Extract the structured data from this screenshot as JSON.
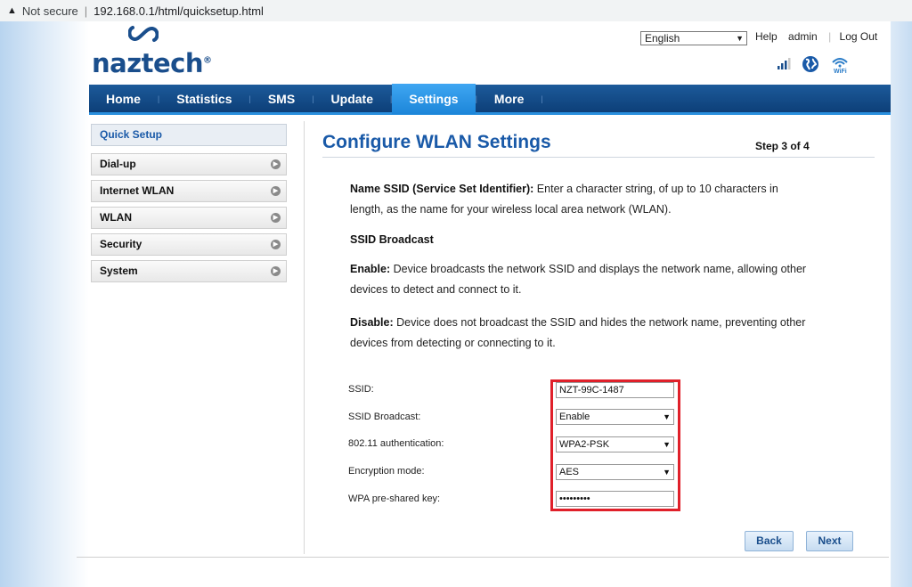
{
  "browser": {
    "security_label": "Not secure",
    "url": "192.168.0.1/html/quicksetup.html"
  },
  "header": {
    "brand": "naztech",
    "brand_mark": "®",
    "language": "English",
    "links": {
      "help": "Help",
      "user": "admin",
      "logout": "Log Out"
    },
    "icons": [
      "signal-icon",
      "globe-icon",
      "wifi-icon"
    ]
  },
  "nav": {
    "items": [
      "Home",
      "Statistics",
      "SMS",
      "Update",
      "Settings",
      "More"
    ],
    "active": "Settings"
  },
  "sidebar": {
    "heading": "Quick Setup",
    "items": [
      "Dial-up",
      "Internet WLAN",
      "WLAN",
      "Security",
      "System"
    ]
  },
  "main": {
    "title": "Configure WLAN Settings",
    "step": "Step 3 of 4",
    "ssid_desc_term": "Name SSID (Service Set Identifier):",
    "ssid_desc_line1": " Enter a character string, of up to 10 characters in",
    "ssid_desc_line2": "length, as the name for your wireless local area network (WLAN).",
    "broadcast_heading": "SSID Broadcast",
    "enable_term": "Enable:",
    "enable_line1": " Device broadcasts the network SSID and displays the network name, allowing other",
    "enable_line2": "devices to detect and connect to it.",
    "disable_term": "Disable:",
    "disable_line1": " Device does not broadcast the SSID and hides the network name, preventing other",
    "disable_line2": "devices from detecting or connecting to it."
  },
  "form": {
    "ssid_label": "SSID:",
    "ssid_value": "NZT-99C-1487",
    "broadcast_label": "SSID Broadcast:",
    "broadcast_value": "Enable",
    "auth_label": "802.11 authentication:",
    "auth_value": "WPA2-PSK",
    "encryption_label": "Encryption mode:",
    "encryption_value": "AES",
    "psk_label": "WPA pre-shared key:",
    "psk_value": "•••••••••"
  },
  "buttons": {
    "back": "Back",
    "next": "Next"
  },
  "colors": {
    "brand": "#1a4e8c",
    "nav": "#0d3f78",
    "nav_active": "#2a8fde",
    "highlight": "#e0202a"
  }
}
